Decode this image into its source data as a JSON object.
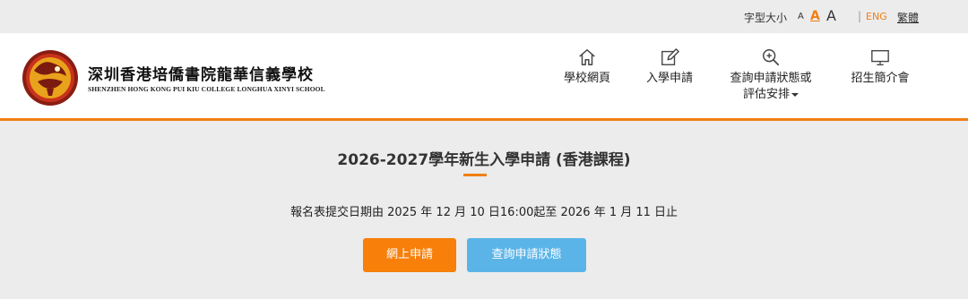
{
  "topbar": {
    "font_size_label": "字型大小",
    "font_small": "A",
    "font_medium": "A",
    "font_large": "A",
    "separator": "|",
    "lang_en": "ENG",
    "lang_tc": "繁體"
  },
  "header": {
    "school_name_cn": "深圳香港培僑書院龍華信義學校",
    "school_name_en": "SHENZHEN HONG KONG PUI KIU COLLEGE LONGHUA XINYI SCHOOL"
  },
  "nav": [
    {
      "label": "學校網頁",
      "icon": "home-icon"
    },
    {
      "label": "入學申請",
      "icon": "edit-icon"
    },
    {
      "label_line1": "查詢申請狀態或",
      "label_line2": "評估安排",
      "icon": "search-plus-icon"
    },
    {
      "label": "招生簡介會",
      "icon": "monitor-icon"
    }
  ],
  "main": {
    "title": "2026-2027學年新生入學申請 (香港課程)",
    "deadline": "報名表提交日期由 2025 年 12 月 10 日16:00起至 2026 年 1 月 11 日止",
    "apply_button": "網上申請",
    "status_button": "查詢申請狀態"
  },
  "colors": {
    "accent": "#f07f13",
    "apply_button": "#f77f0a",
    "status_button": "#5bb4e8",
    "background": "#ececec"
  }
}
